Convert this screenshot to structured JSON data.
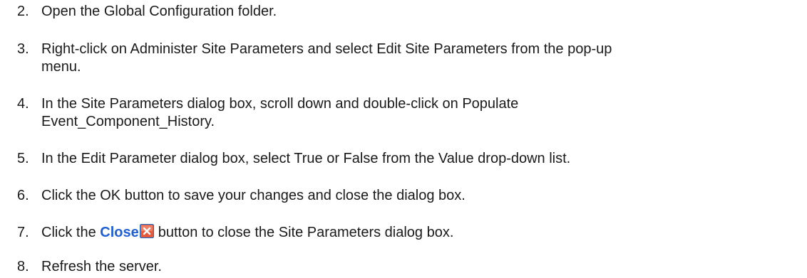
{
  "steps": [
    {
      "number": "2.",
      "lines": [
        "Open the Global Configuration folder."
      ]
    },
    {
      "number": "3.",
      "lines": [
        "Right-click on Administer Site Parameters and select Edit Site Parameters from the pop-up",
        "menu."
      ]
    },
    {
      "number": "4.",
      "lines": [
        "In the Site Parameters dialog box, scroll down and double-click on Populate",
        "Event_Component_History."
      ]
    },
    {
      "number": "5.",
      "lines": [
        "In the Edit Parameter dialog box, select True or False from the Value drop-down list."
      ]
    },
    {
      "number": "6.",
      "lines": [
        "Click the OK button to save your changes and close the dialog box."
      ]
    },
    {
      "number": "7.",
      "before": "Click the ",
      "link_label": "Close",
      "icon": "close-icon",
      "after": "button to close the Site Parameters dialog box."
    },
    {
      "number": "8.",
      "lines": [
        "Refresh the server."
      ]
    }
  ],
  "colors": {
    "text": "#1a1a1a",
    "link": "#1f5fd6",
    "close_icon_bg": "#e85a3c",
    "close_icon_border": "#1e6ec8"
  }
}
